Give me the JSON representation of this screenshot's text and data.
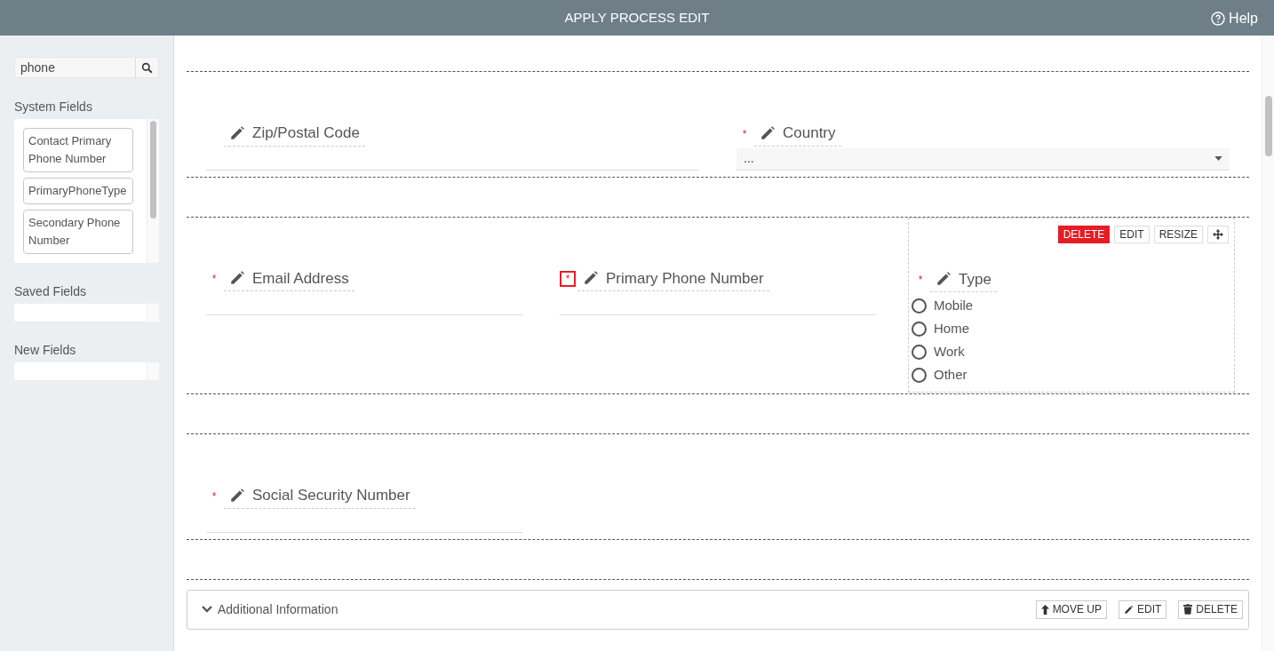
{
  "header": {
    "title": "APPLY PROCESS EDIT",
    "help": "Help"
  },
  "sidebar": {
    "search": {
      "value": "phone"
    },
    "sections": [
      {
        "title": "System Fields",
        "items": [
          "Contact Primary Phone Number",
          "PrimaryPhoneType",
          "Secondary Phone Number"
        ]
      },
      {
        "title": "Saved Fields"
      },
      {
        "title": "New Fields"
      }
    ]
  },
  "rows": [
    {
      "fields": [
        {
          "kind": "text",
          "label": "Zip/Postal Code",
          "selected": false
        },
        {
          "kind": "select",
          "label": "Country",
          "required_mark": "*",
          "highlighted": false,
          "selected": false,
          "value": "..."
        }
      ]
    },
    {
      "fields": [
        {
          "kind": "text",
          "label": "Email Address",
          "required_mark": "*",
          "highlighted": false,
          "selected": false
        },
        {
          "kind": "text",
          "label": "Primary Phone Number",
          "required_mark": "*",
          "highlighted": true,
          "selected": false
        },
        {
          "kind": "radio",
          "label": "Type",
          "required_mark": "*",
          "highlighted": false,
          "selected": true,
          "actions": [
            "DELETE",
            "EDIT",
            "RESIZE"
          ],
          "options": [
            {
              "label": "Mobile",
              "selected": false
            },
            {
              "label": "Home",
              "selected": false
            },
            {
              "label": "Work",
              "selected": false
            },
            {
              "label": "Other",
              "selected": false
            }
          ]
        }
      ]
    },
    {
      "fields": [
        {
          "kind": "text",
          "label": "Social Security Number",
          "required_mark": "*",
          "highlighted": false,
          "selected": false
        }
      ]
    }
  ],
  "section_panel": {
    "title": "Additional Information",
    "expanded": true,
    "actions": [
      {
        "kind": "move",
        "label": "MOVE UP"
      },
      {
        "kind": "edit",
        "label": "EDIT"
      },
      {
        "kind": "delete",
        "label": "DELETE"
      }
    ]
  }
}
